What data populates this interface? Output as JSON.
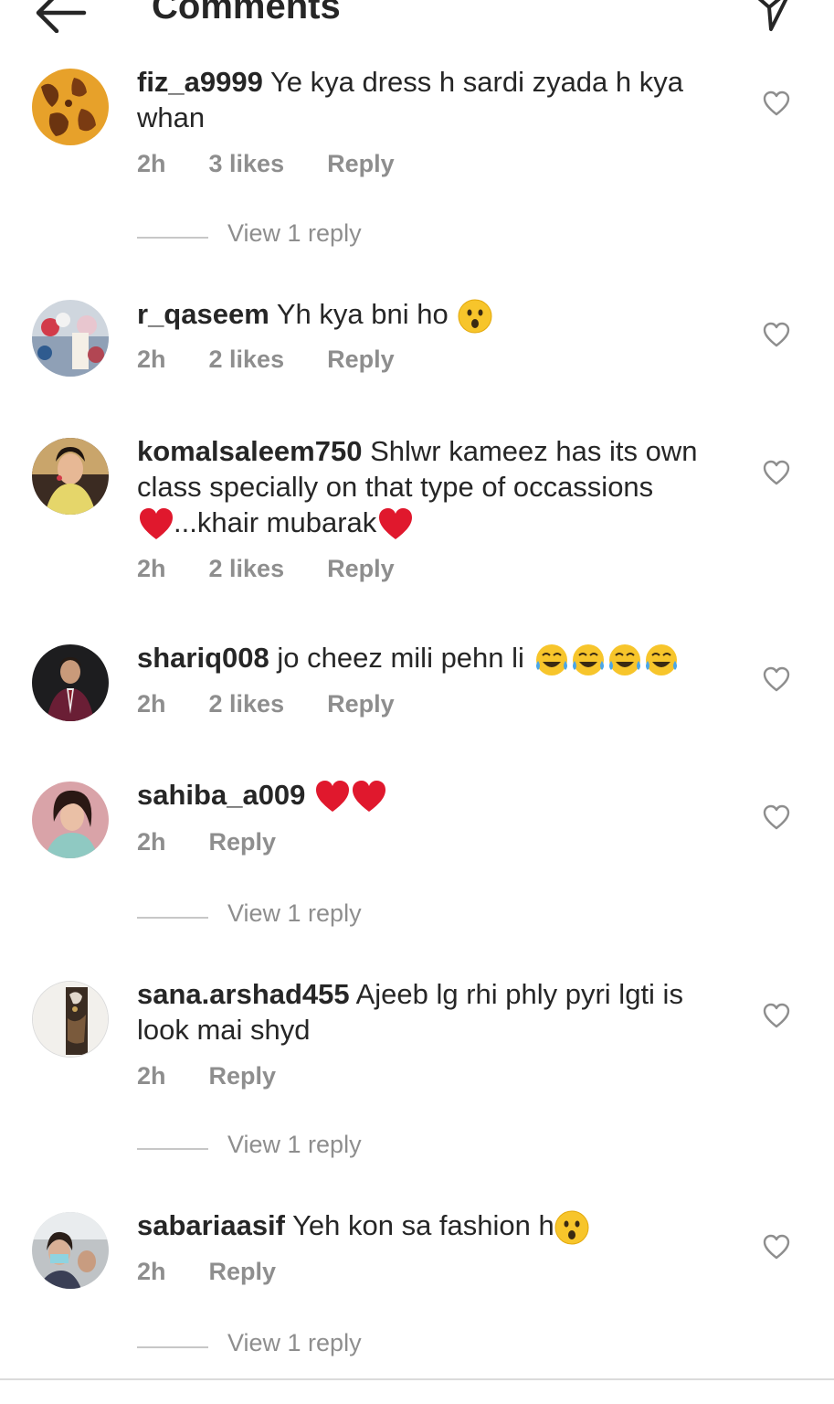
{
  "header": {
    "title": "Comments",
    "back_icon": "arrow-left-icon",
    "send_icon": "send-icon"
  },
  "comments": [
    {
      "user": "fiz_a9999",
      "text": "Ye kya dress h sardi zyada h kya whan",
      "time": "2h",
      "likes": "3 likes",
      "reply": "Reply",
      "view_replies": "View 1 reply"
    },
    {
      "user": "r_qaseem",
      "text": "Yh kya bni ho",
      "time": "2h",
      "likes": "2 likes",
      "reply": "Reply"
    },
    {
      "user": "komalsaleem750",
      "text": "Shlwr kameez has its own class specially on that type of occassions",
      "text2": "...khair mubarak",
      "time": "2h",
      "likes": "2 likes",
      "reply": "Reply"
    },
    {
      "user": "shariq008",
      "text": "jo cheez mili pehn li",
      "time": "2h",
      "likes": "2 likes",
      "reply": "Reply"
    },
    {
      "user": "sahiba_a009",
      "text": "",
      "time": "2h",
      "reply": "Reply",
      "view_replies": "View 1 reply"
    },
    {
      "user": "sana.arshad455",
      "text": "Ajeeb lg rhi phly pyri lgti is look mai shyd",
      "time": "2h",
      "reply": "Reply",
      "view_replies": "View 1 reply"
    },
    {
      "user": "sabariaasif",
      "text": "Yeh kon sa fashion h",
      "time": "2h",
      "reply": "Reply",
      "view_replies": "View 1 reply"
    }
  ],
  "colors": {
    "text": "#262626",
    "muted": "#8e8e8e",
    "heart_red": "#e0182d"
  }
}
